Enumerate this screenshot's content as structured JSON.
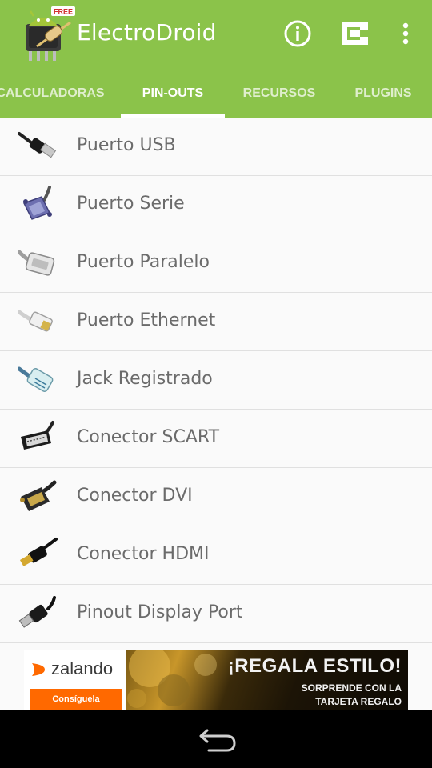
{
  "app": {
    "title": "ElectroDroid",
    "logo_badge": "FREE",
    "colors": {
      "primary": "#8bc34a",
      "text_primary": "#6b6b6b",
      "divider": "#e0e0e0"
    }
  },
  "actionbar": {
    "icons": [
      "info-icon",
      "plugin-icon",
      "more-options-icon"
    ]
  },
  "tabs": [
    {
      "label": "CALCULADORAS",
      "selected": false
    },
    {
      "label": "PIN-OUTS",
      "selected": true
    },
    {
      "label": "RECURSOS",
      "selected": false
    },
    {
      "label": "PLUGINS",
      "selected": false
    }
  ],
  "list": [
    {
      "label": "Puerto USB",
      "icon": "usb-cable-icon"
    },
    {
      "label": "Puerto Serie",
      "icon": "serial-connector-icon"
    },
    {
      "label": "Puerto Paralelo",
      "icon": "parallel-connector-icon"
    },
    {
      "label": "Puerto Ethernet",
      "icon": "ethernet-cable-icon"
    },
    {
      "label": "Jack Registrado",
      "icon": "rj-jack-icon"
    },
    {
      "label": "Conector SCART",
      "icon": "scart-connector-icon"
    },
    {
      "label": "Conector DVI",
      "icon": "dvi-connector-icon"
    },
    {
      "label": "Conector HDMI",
      "icon": "hdmi-cable-icon"
    },
    {
      "label": "Pinout Display Port",
      "icon": "displayport-cable-icon"
    }
  ],
  "ad": {
    "brand": "zalando",
    "cta": "Consíguela",
    "headline": "¡REGALA ESTILO!",
    "sub_line1": "SORPRENDE CON LA",
    "sub_line2": "TARJETA REGALO",
    "brand_color": "#ff6900"
  },
  "navbar": {
    "icons": [
      "back-icon"
    ]
  }
}
